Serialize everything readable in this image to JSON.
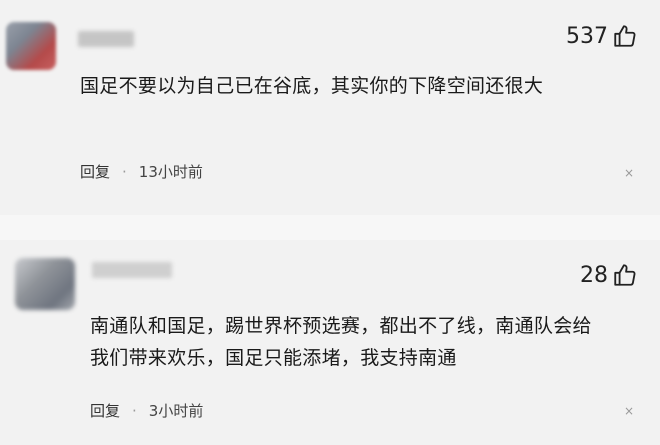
{
  "comments": [
    {
      "likes": "537",
      "text": "国足不要以为自己已在谷底，其实你的下降空间还很大",
      "reply_label": "回复",
      "separator": "·",
      "time": "13小时前",
      "close_glyph": "×"
    },
    {
      "likes": "28",
      "text": "南通队和国足，踢世界杯预选赛，都出不了线，南通队会给我们带来欢乐，国足只能添堵，我支持南通",
      "reply_label": "回复",
      "separator": "·",
      "time": "3小时前",
      "close_glyph": "×"
    }
  ],
  "icons": {
    "like": "thumbs-up-icon",
    "dismiss": "close-icon"
  }
}
